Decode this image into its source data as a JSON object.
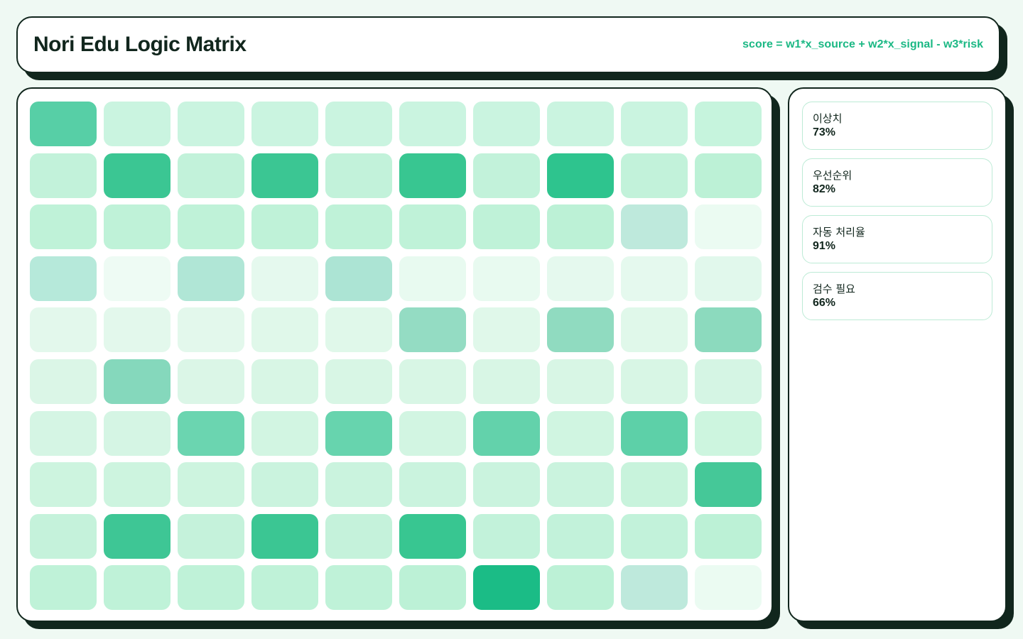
{
  "header": {
    "title": "Nori Edu Logic Matrix",
    "formula": "score = w1*x_source + w2*x_signal - w3*risk"
  },
  "matrix": {
    "rows": [
      [
        "#57cfa6",
        "#caf4e0",
        "#caf4e0",
        "#caf4e0",
        "#caf4e0",
        "#caf4e0",
        "#caf4e0",
        "#caf4e0",
        "#caf4e0",
        "#c6f4dd"
      ],
      [
        "#c2f2da",
        "#3bc693",
        "#c2f2da",
        "#3bc693",
        "#c2f2da",
        "#38c691",
        "#c2f2da",
        "#2ec48e",
        "#c2f2da",
        "#bcf1d6"
      ],
      [
        "#bff2d8",
        "#bff2d8",
        "#bff2d8",
        "#bff2d8",
        "#bff2d8",
        "#bff2d8",
        "#bff2d8",
        "#bcf1d6",
        "#bee9dc",
        "#ebfbf2"
      ],
      [
        "#b6e9da",
        "#eefbf4",
        "#b0e6d6",
        "#e5f9ee",
        "#ace4d4",
        "#e8faf0",
        "#e8faf0",
        "#e5f9ee",
        "#e5f9ee",
        "#e1f8ec"
      ],
      [
        "#e3f8ec",
        "#e3f8ec",
        "#e3f8ec",
        "#e0f8ea",
        "#e0f8ea",
        "#94dcc3",
        "#e0f8ea",
        "#90dbc0",
        "#e0f8ea",
        "#8cdabe"
      ],
      [
        "#dbf6e7",
        "#85d8bc",
        "#dbf6e7",
        "#d8f6e5",
        "#d8f6e5",
        "#d8f6e5",
        "#d8f6e5",
        "#d8f6e5",
        "#d8f6e5",
        "#d5f5e4"
      ],
      [
        "#d5f5e4",
        "#d5f5e4",
        "#6bd5b0",
        "#d2f5e2",
        "#67d4ae",
        "#d2f5e2",
        "#63d2ab",
        "#d0f5e1",
        "#5dd0a8",
        "#cdf5df"
      ],
      [
        "#cdf4df",
        "#cdf4df",
        "#cdf4df",
        "#caf3de",
        "#caf3de",
        "#caf3de",
        "#caf3de",
        "#caf3de",
        "#c8f3dc",
        "#45c898"
      ],
      [
        "#c5f2db",
        "#3ec695",
        "#c5f2db",
        "#3bc693",
        "#c5f2db",
        "#38c691",
        "#c2f2da",
        "#c2f2da",
        "#c2f2da",
        "#bcf1d6"
      ],
      [
        "#bff2d8",
        "#bff2d8",
        "#bff2d8",
        "#bff2d8",
        "#bff2d8",
        "#bcf1d6",
        "#1bbc86",
        "#bcf1d6",
        "#bee9dc",
        "#ebfbf2"
      ]
    ]
  },
  "stats": [
    {
      "label": "이상치",
      "value": "73%"
    },
    {
      "label": "우선순위",
      "value": "82%"
    },
    {
      "label": "자동 처리율",
      "value": "91%"
    },
    {
      "label": "검수 필요",
      "value": "66%"
    }
  ]
}
